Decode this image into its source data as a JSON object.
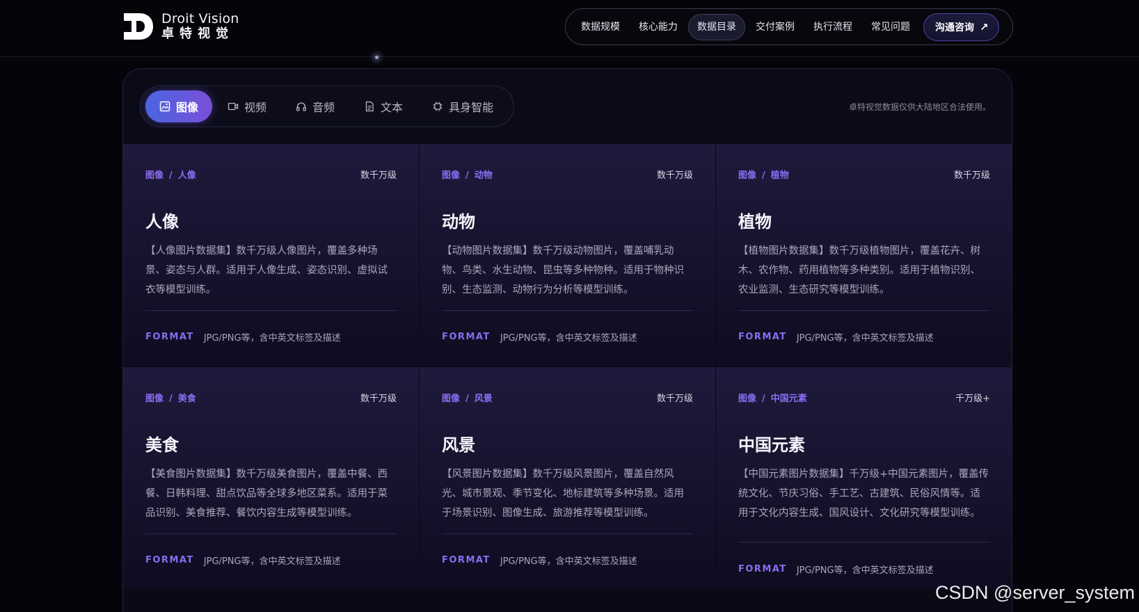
{
  "brand": {
    "name_en": "Droit Vision",
    "name_cn": "卓特视觉"
  },
  "nav": {
    "items": [
      "数据规模",
      "核心能力",
      "数据目录",
      "交付案例",
      "执行流程",
      "常见问题"
    ],
    "active_index": 2,
    "cta_label": "沟通咨询"
  },
  "tabs": [
    {
      "label": "图像",
      "icon": "image-icon",
      "active": true
    },
    {
      "label": "视频",
      "icon": "video-icon",
      "active": false
    },
    {
      "label": "音频",
      "icon": "headphones-icon",
      "active": false
    },
    {
      "label": "文本",
      "icon": "document-icon",
      "active": false
    },
    {
      "label": "具身智能",
      "icon": "chip-icon",
      "active": false
    }
  ],
  "notice": "卓特视觉数据仅供大陆地区合法使用。",
  "format_label": "FORMAT",
  "cards": [
    {
      "crumb_parent": "图像",
      "crumb_child": "人像",
      "scale": "数千万级",
      "title": "人像",
      "desc": "【人像图片数据集】数千万级人像图片，覆盖多种场景、姿态与人群。适用于人像生成、姿态识别、虚拟试衣等模型训练。",
      "format": "JPG/PNG等，含中英文标签及描述"
    },
    {
      "crumb_parent": "图像",
      "crumb_child": "动物",
      "scale": "数千万级",
      "title": "动物",
      "desc": "【动物图片数据集】数千万级动物图片，覆盖哺乳动物、鸟类、水生动物、昆虫等多种物种。适用于物种识别、生态监测、动物行为分析等模型训练。",
      "format": "JPG/PNG等，含中英文标签及描述"
    },
    {
      "crumb_parent": "图像",
      "crumb_child": "植物",
      "scale": "数千万级",
      "title": "植物",
      "desc": "【植物图片数据集】数千万级植物图片，覆盖花卉、树木、农作物、药用植物等多种类别。适用于植物识别、农业监测、生态研究等模型训练。",
      "format": "JPG/PNG等，含中英文标签及描述"
    },
    {
      "crumb_parent": "图像",
      "crumb_child": "美食",
      "scale": "数千万级",
      "title": "美食",
      "desc": "【美食图片数据集】数千万级美食图片，覆盖中餐、西餐、日韩料理、甜点饮品等全球多地区菜系。适用于菜品识别、美食推荐、餐饮内容生成等模型训练。",
      "format": "JPG/PNG等，含中英文标签及描述"
    },
    {
      "crumb_parent": "图像",
      "crumb_child": "风景",
      "scale": "数千万级",
      "title": "风景",
      "desc": "【风景图片数据集】数千万级风景图片，覆盖自然风光、城市景观、季节变化、地标建筑等多种场景。适用于场景识别、图像生成、旅游推荐等模型训练。",
      "format": "JPG/PNG等，含中英文标签及描述"
    },
    {
      "crumb_parent": "图像",
      "crumb_child": "中国元素",
      "scale": "千万级+",
      "title": "中国元素",
      "desc": "【中国元素图片数据集】千万级+中国元素图片，覆盖传统文化、节庆习俗、手工艺、古建筑、民俗风情等。适用于文化内容生成、国风设计、文化研究等模型训练。",
      "format": "JPG/PNG等，含中英文标签及描述"
    }
  ],
  "watermark": "CSDN @server_system"
}
